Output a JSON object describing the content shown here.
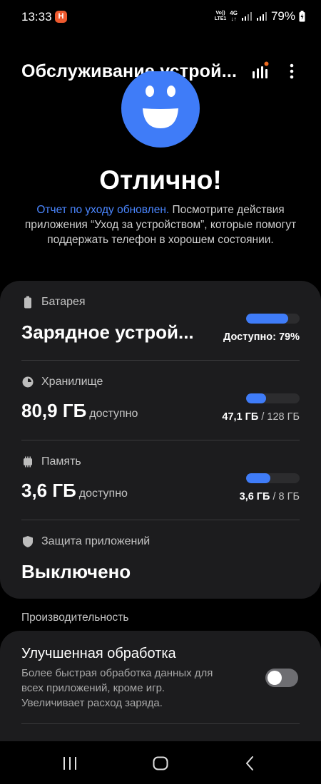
{
  "status_bar": {
    "time": "13:33",
    "notification_badge": "H",
    "volte_label": "Vo))\nLTE1",
    "network_label": "4G",
    "battery_percent": "79%"
  },
  "header": {
    "title": "Обслуживание устрой...",
    "report_icon": "signal-bars-icon",
    "more_icon": "more-vertical-icon"
  },
  "status": {
    "face_icon": "happy-face-icon",
    "title": "Отлично!",
    "link_text": "Отчет по уходу обновлен.",
    "description": " Посмотрите действия приложения “Уход за устройством”, которые помогут поддержать телефон в хорошем состоянии."
  },
  "battery": {
    "label": "Батарея",
    "value": "Зарядное устрой...",
    "right_text": "Доступно: 79%",
    "level": 0.79
  },
  "storage": {
    "label": "Хранилище",
    "value": "80,9 ГБ",
    "sub": "доступно",
    "used": "47,1 ГБ",
    "total": " / 128 ГБ",
    "level": 0.37
  },
  "memory": {
    "label": "Память",
    "value": "3,6 ГБ",
    "sub": "доступно",
    "used": "3,6 ГБ",
    "total": " / 8 ГБ",
    "level": 0.45
  },
  "app_protection": {
    "label": "Защита приложений",
    "value": "Выключено"
  },
  "performance": {
    "section_title": "Производительность",
    "item_title": "Улучшенная обработка",
    "item_desc": "Более быстрая обработка данных для всех приложений, кроме игр. Увеличивает расход заряда.",
    "toggle_on": false
  },
  "colors": {
    "accent": "#3f7cf8",
    "link": "#4a86ff",
    "card": "#1c1c1e",
    "notification": "#ee5a2f"
  }
}
